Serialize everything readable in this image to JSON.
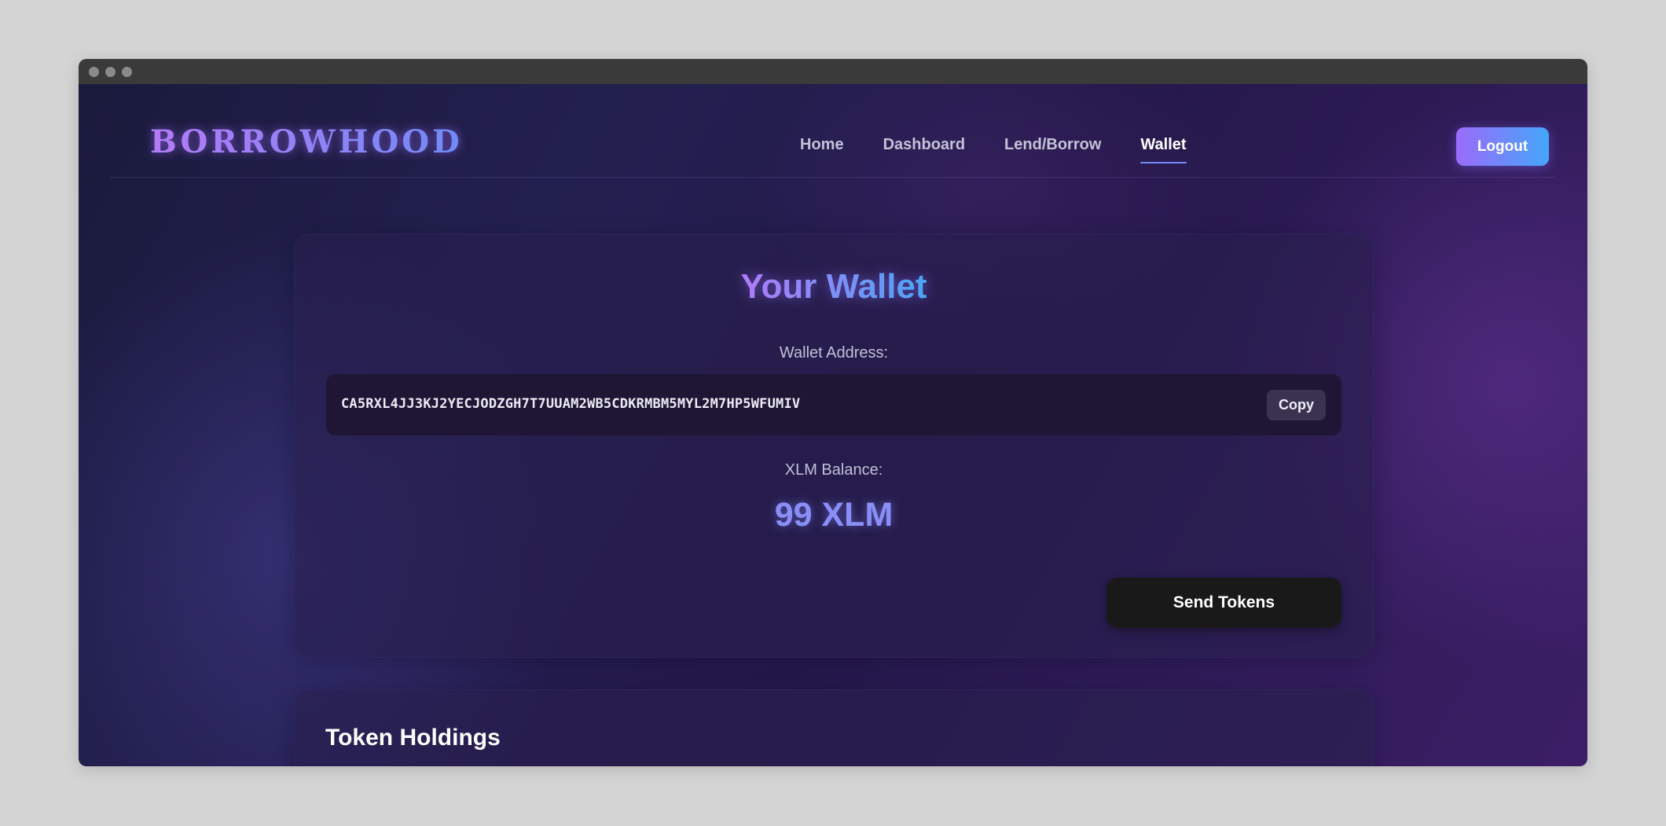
{
  "window": {
    "title_dots": 3
  },
  "brand": {
    "logo_text": "BORROWHOOD"
  },
  "nav": {
    "items": [
      {
        "label": "Home",
        "active": false
      },
      {
        "label": "Dashboard",
        "active": false
      },
      {
        "label": "Lend/Borrow",
        "active": false
      },
      {
        "label": "Wallet",
        "active": true
      }
    ],
    "logout_label": "Logout"
  },
  "wallet": {
    "title": "Your Wallet",
    "address_label": "Wallet Address:",
    "address": "CA5RXL4JJ3KJ2YECJODZGH7T7UUAM2WB5CDKRMBM5MYL2M7HP5WFUMIV",
    "copy_label": "Copy",
    "balance_label": "XLM Balance:",
    "balance": "99 XLM",
    "send_label": "Send Tokens"
  },
  "holdings": {
    "title": "Token Holdings"
  },
  "colors": {
    "accent_purple": "#b27af7",
    "accent_blue": "#4aa5f5",
    "balance_color": "#8a8ff8",
    "send_button_bg": "#191919"
  }
}
